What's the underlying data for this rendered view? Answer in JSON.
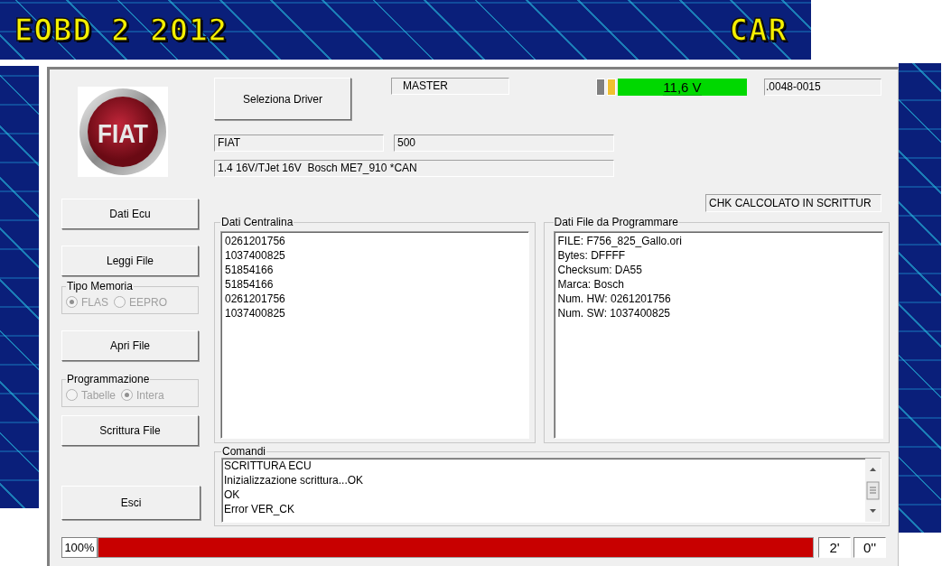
{
  "banner": {
    "title": "EOBD 2 2012",
    "subtitle": "CAR"
  },
  "logo": {
    "text": "FIAT"
  },
  "sidebar": {
    "buttons": [
      "Dati Ecu",
      "Leggi File",
      "Apri File",
      "Scrittura File",
      "Esci"
    ],
    "memory_type": {
      "label": "Tipo Memoria",
      "options": [
        {
          "label": "FLAS",
          "selected": true,
          "disabled": true
        },
        {
          "label": "EEPRO",
          "selected": false,
          "disabled": true
        }
      ]
    },
    "programming": {
      "label": "Programmazione",
      "options": [
        {
          "label": "Tabelle",
          "selected": false,
          "disabled": true
        },
        {
          "label": "Intera",
          "selected": true,
          "disabled": true
        }
      ]
    }
  },
  "header": {
    "driver_button": "Seleziona Driver",
    "mode": "MASTER",
    "voltage": "11,6 V",
    "code": ".0048-0015"
  },
  "vehicle": {
    "make": "FIAT",
    "model": "500",
    "engine": "1.4 16V/TJet 16V  Bosch ME7_910 *CAN"
  },
  "checksum_status": "CHK CALCOLATO IN SCRITTUR",
  "ecu_data": {
    "label": "Dati Centralina",
    "items": [
      "0261201756",
      "1037400825",
      "51854166",
      "51854166",
      "0261201756",
      "1037400825"
    ]
  },
  "file_data": {
    "label": "Dati File da Programmare",
    "items": [
      "FILE: F756_825_Gallo.ori",
      "Bytes: DFFFF",
      "Checksum: DA55",
      "Marca: Bosch",
      "Num. HW: 0261201756",
      "Num. SW: 1037400825"
    ]
  },
  "commands": {
    "label": "Comandi",
    "lines": [
      "SCRITTURA ECU",
      "Inizializzazione scrittura...OK",
      "OK",
      "Error VER_CK"
    ]
  },
  "progress": {
    "reading": "100%",
    "level": 1,
    "minutes": "2'",
    "seconds": "0''"
  }
}
